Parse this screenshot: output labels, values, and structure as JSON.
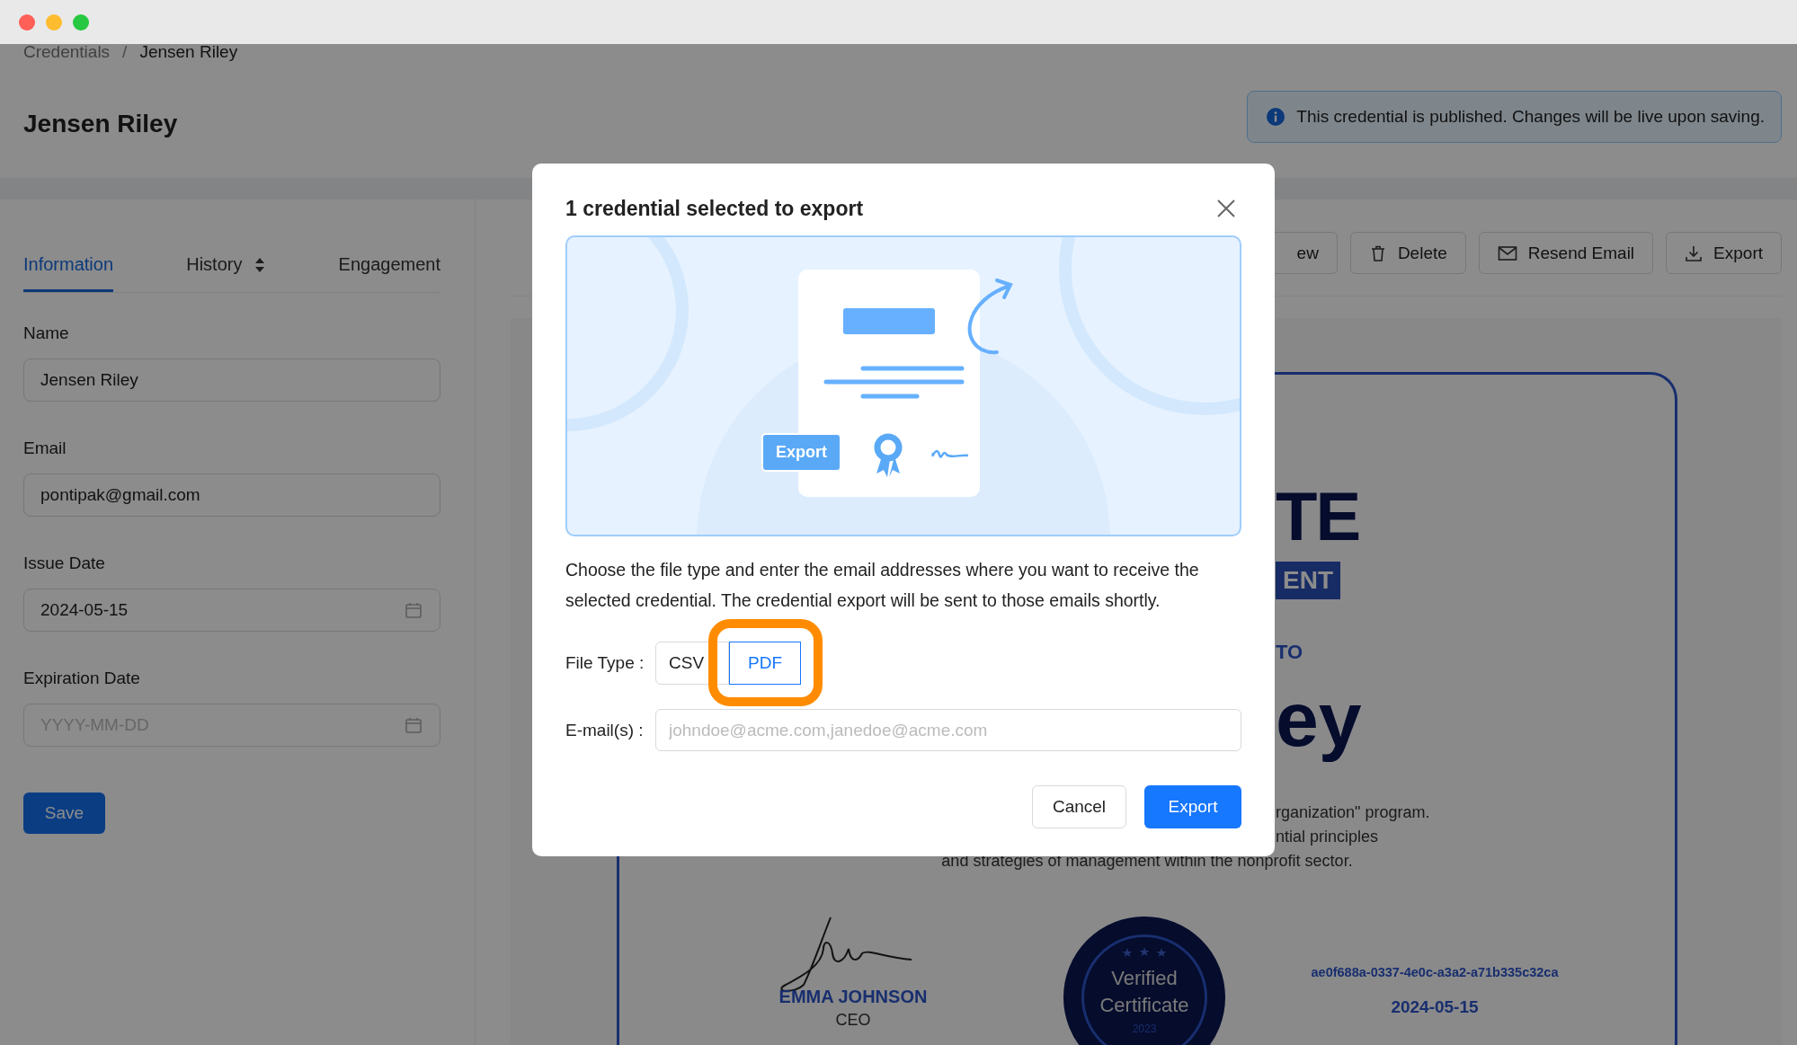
{
  "breadcrumb": {
    "items": [
      {
        "label": "Credentials"
      },
      {
        "label": "Jensen Riley"
      }
    ],
    "separator": "/"
  },
  "page_title": "Jensen Riley",
  "notice": {
    "text": "This credential is published. Changes will be live upon saving."
  },
  "tabs": [
    {
      "label": "Information",
      "selected": true,
      "sortable": false
    },
    {
      "label": "History",
      "selected": false,
      "sortable": true
    },
    {
      "label": "Engagement",
      "selected": false,
      "sortable": false
    }
  ],
  "form": {
    "fields": [
      {
        "label": "Name",
        "value": "Jensen Riley",
        "kind": "text"
      },
      {
        "label": "Email",
        "value": "pontipak@gmail.com",
        "kind": "text"
      },
      {
        "label": "Issue Date",
        "value": "2024-05-15",
        "kind": "date"
      },
      {
        "label": "Expiration Date",
        "placeholder": "YYYY-MM-DD",
        "kind": "date"
      }
    ],
    "save_button": "Save"
  },
  "toolbar": [
    {
      "label": "ew",
      "kind": "partial"
    },
    {
      "label": "Delete",
      "kind": "trash"
    },
    {
      "label": "Resend Email",
      "kind": "mail"
    },
    {
      "label": "Export",
      "kind": "download"
    }
  ],
  "certificate": {
    "title_part": "TE",
    "subtitle_part": "ENT",
    "presented_part": "TO",
    "name_part": "ey",
    "description_lines": [
      "rganization\" program.",
      "ntial principles",
      "and strategies of management within the nonprofit sector."
    ],
    "signer_name": "EMMA JOHNSON",
    "signer_role": "CEO",
    "seal_lines": [
      "Verified",
      "Certificate"
    ],
    "seal_year": "2023",
    "credential_id": "ae0f688a-0337-4e0c-a3a2-a71b335c32ca",
    "date": "2024-05-15"
  },
  "dialog": {
    "title": "1 credential selected to export",
    "illustration_label": "Export",
    "message": "Choose the file type and enter the email addresses where you want to receive the selected credential. The credential export will be sent to those emails shortly.",
    "file_type_label": "File Type :",
    "file_types": [
      {
        "label": "CSV",
        "selected": false,
        "highlighted": false
      },
      {
        "label": "PDF",
        "selected": true,
        "highlighted": true
      }
    ],
    "email_label": "E-mail(s) :",
    "email_placeholder": "johndoe@acme.com,janedoe@acme.com",
    "cancel_button": "Cancel",
    "export_button": "Export"
  }
}
